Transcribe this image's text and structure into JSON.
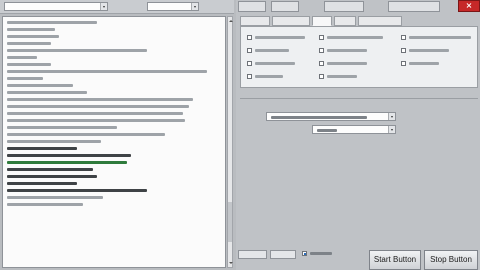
{
  "toolbar": {
    "exit_label": "×"
  },
  "option_tabs": {
    "active_index": 2
  },
  "options": [
    {
      "checked": false
    },
    {
      "checked": false
    },
    {
      "checked": false
    },
    {
      "checked": false
    },
    {
      "checked": false
    },
    {
      "checked": false
    },
    {
      "checked": false
    },
    {
      "checked": false
    },
    {
      "checked": false
    },
    {
      "checked": false
    },
    {
      "checked": false
    },
    {
      "checked": false
    }
  ],
  "mini_controls": {
    "checkbox_checked": true
  },
  "actions": {
    "start_label": "Start Button",
    "stop_label": "Stop Button"
  },
  "colors": {
    "exit_button": "#c62828",
    "log_success": "#2f7b3c",
    "checkbox_mark": "#2a6ebd"
  }
}
